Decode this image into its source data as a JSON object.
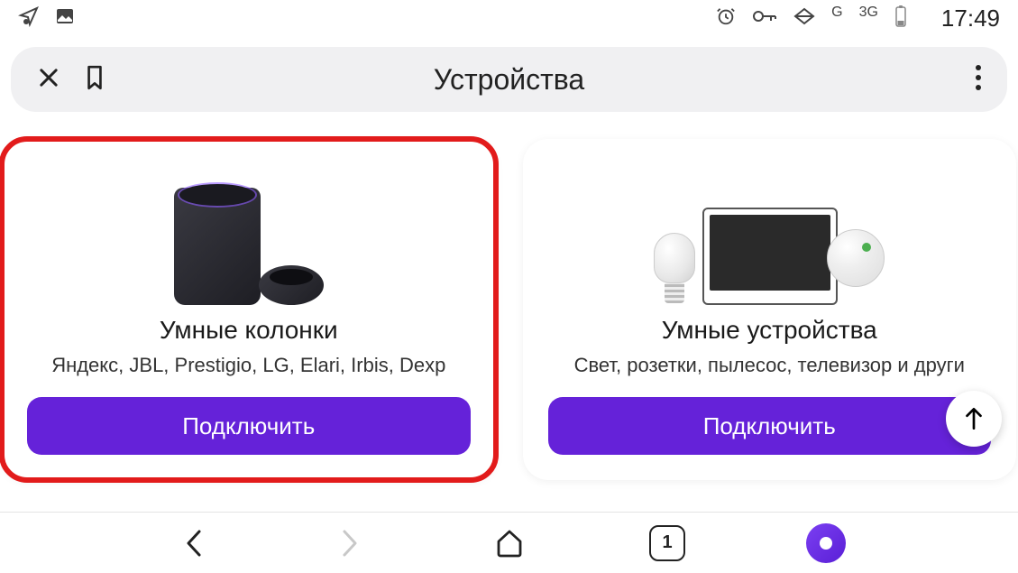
{
  "status": {
    "time": "17:49",
    "signal_g": "G",
    "signal_3g": "3G"
  },
  "header": {
    "title": "Устройства"
  },
  "cards": [
    {
      "title": "Умные колонки",
      "subtitle": "Яндекс, JBL, Prestigio, LG, Elari, Irbis, Dexp",
      "button": "Подключить"
    },
    {
      "title": "Умные устройства",
      "subtitle": "Свет, розетки, пылесос, телевизор и други",
      "button": "Подключить"
    }
  ],
  "nav": {
    "tabs_count": "1"
  },
  "fab_icon": "↑"
}
